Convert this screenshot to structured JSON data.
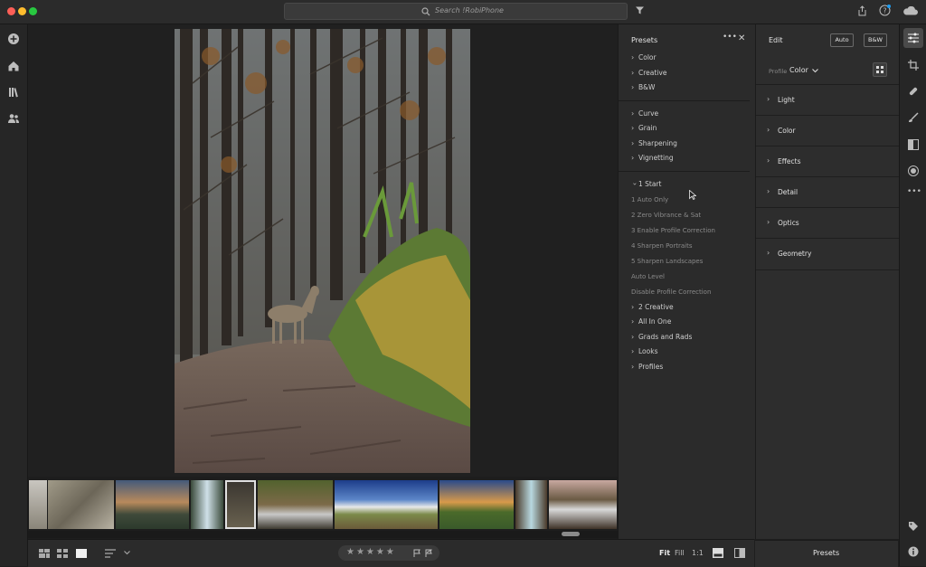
{
  "search": {
    "placeholder": "Search !RobiPhone"
  },
  "presets": {
    "title": "Presets",
    "group1": [
      {
        "label": "Color"
      },
      {
        "label": "Creative"
      },
      {
        "label": "B&W"
      }
    ],
    "group2": [
      {
        "label": "Curve"
      },
      {
        "label": "Grain"
      },
      {
        "label": "Sharpening"
      },
      {
        "label": "Vignetting"
      }
    ],
    "expanded": {
      "label": "1 Start"
    },
    "subitems": [
      {
        "label": "1 Auto Only"
      },
      {
        "label": "2 Zero Vibrance & Sat"
      },
      {
        "label": "3 Enable Profile Correction"
      },
      {
        "label": "4 Sharpen Portraits"
      },
      {
        "label": "5 Sharpen Landscapes"
      },
      {
        "label": "Auto Level"
      },
      {
        "label": "Disable Profile Correction"
      }
    ],
    "group3": [
      {
        "label": "2 Creative"
      },
      {
        "label": "All In One"
      },
      {
        "label": "Grads and Rads"
      },
      {
        "label": "Looks"
      },
      {
        "label": "Profiles"
      }
    ]
  },
  "edit": {
    "title": "Edit",
    "auto_label": "Auto",
    "bw_label": "B&W",
    "profile_label": "Profile",
    "profile_value": "Color",
    "sections": [
      {
        "label": "Light"
      },
      {
        "label": "Color"
      },
      {
        "label": "Effects"
      },
      {
        "label": "Detail"
      },
      {
        "label": "Optics"
      },
      {
        "label": "Geometry"
      }
    ]
  },
  "bottom": {
    "fit": "Fit",
    "fill": "Fill",
    "one_to_one": "1:1"
  },
  "presets_button": "Presets",
  "colors": {
    "accent": "#d9d9d9",
    "panel": "#2b2b2b",
    "background": "#1e1e1e"
  }
}
